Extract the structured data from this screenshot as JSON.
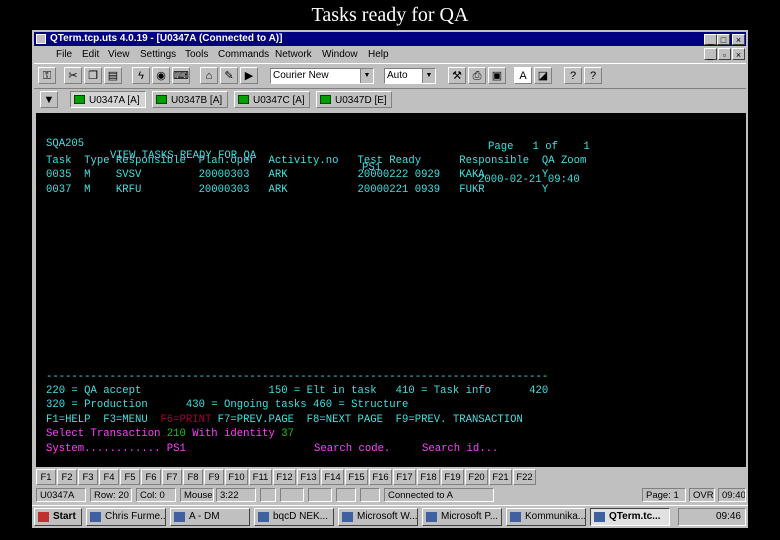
{
  "slide": {
    "title": "Tasks ready for QA"
  },
  "window": {
    "title": "QTerm.tcp.uts 4.0.19 - [U0347A (Connected to A)]",
    "controls": {
      "minimize": "_",
      "maximize": "□",
      "close": "×"
    }
  },
  "menu": [
    "File",
    "Edit",
    "View",
    "Settings",
    "Tools",
    "Commands",
    "Network",
    "Window",
    "Help"
  ],
  "toolbar": {
    "font": "Courier New",
    "size": "Auto"
  },
  "sessions": [
    "U0347A [A]",
    "U0347B [A]",
    "U0347C [A]",
    "U0347D [E]"
  ],
  "terminal": {
    "header": {
      "screen_id": "SQA205",
      "title": "VIEW TASKS READY FOR QA",
      "system": "PS1",
      "datetime": "2000-02-21 09:40"
    },
    "page_line": "Page   1 of    1",
    "columns": "Task  Type Responsible  Plan.oper  Activity.no   Test Ready      Responsible  QA Zoom",
    "rows": [
      "0035  M    SVSV         20000303   ARK           20000222 0929   KAKA         Y",
      "0037  M    KRFU         20000303   ARK           20000221 0939   FUKR         Y"
    ],
    "separator": "-------------------------------------------------------------------------------",
    "opt1": "220 = QA accept                    150 = Elt in task   410 = Task info      420",
    "opt2": "320 = Production      430 = Ongoing tasks 460 = Structure",
    "fkeys_a": "F1=HELP  F3=MENU  ",
    "fkeys_print": "F6=PRINT",
    "fkeys_b": " F7=PREV.PAGE  F8=NEXT PAGE  F9=PREV. TRANSACTION",
    "select_label": "Select Transaction",
    "select_value": "210",
    "identity_label": "With identity",
    "identity_value": "37",
    "system_label": "System............",
    "system_value": "PS1",
    "search_code": "Search code.",
    "search_id": "Search id..."
  },
  "function_keys": [
    "F1",
    "F2",
    "F3",
    "F4",
    "F5",
    "F6",
    "F7",
    "F8",
    "F9",
    "F10",
    "F11",
    "F12",
    "F13",
    "F14",
    "F15",
    "F16",
    "F17",
    "F18",
    "F19",
    "F20",
    "F21",
    "F22"
  ],
  "statusbar": {
    "session": "U0347A",
    "row": "Row: 20",
    "col": "Col: 0",
    "mouse": "Mouse:",
    "mouse_pos": "3:22",
    "connection": "Connected to A",
    "page": "Page: 1",
    "mode": "OVR",
    "time": "09:40"
  },
  "taskbar": {
    "start": "Start",
    "items": [
      "Chris Furme...",
      "A - DM",
      "bqcD NEK...",
      "Microsoft W...",
      "Microsoft P...",
      "Kommunika...",
      "QTerm.tc..."
    ],
    "clock": "09:46"
  }
}
